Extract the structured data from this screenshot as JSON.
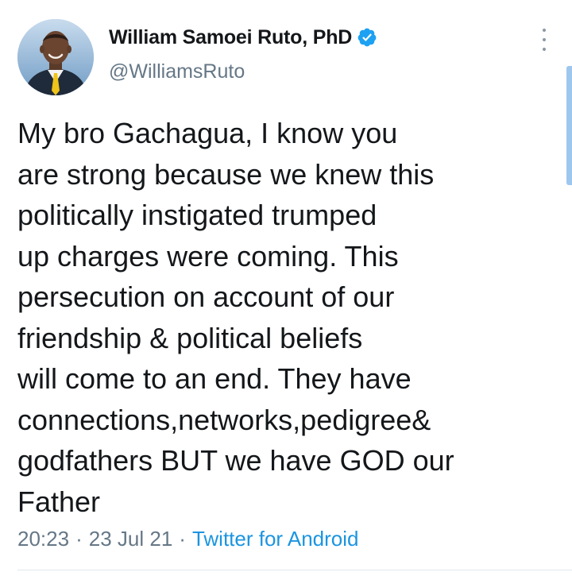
{
  "author": {
    "display_name": "William Samoei Ruto, PhD",
    "handle": "@WilliamsRuto",
    "verified": true,
    "avatar_icon": "profile-photo"
  },
  "tweet": {
    "text": "My bro Gachagua, I know you\nare strong because we knew this\npolitically instigated trumped\nup charges were coming. This\npersecution on account of our\nfriendship & political beliefs\nwill come to an end. They have\nconnections,networks,pedigree&\ngodfathers BUT we have GOD our\nFather",
    "time": "20:23",
    "date": "23 Jul 21",
    "separator": "·",
    "source": "Twitter for Android"
  },
  "icons": {
    "verified_badge": "verified-badge-icon",
    "more": "more-vertical-icon"
  },
  "colors": {
    "text": "#14171a",
    "secondary": "#657786",
    "link": "#1b95e0",
    "verified": "#1da1f2"
  }
}
